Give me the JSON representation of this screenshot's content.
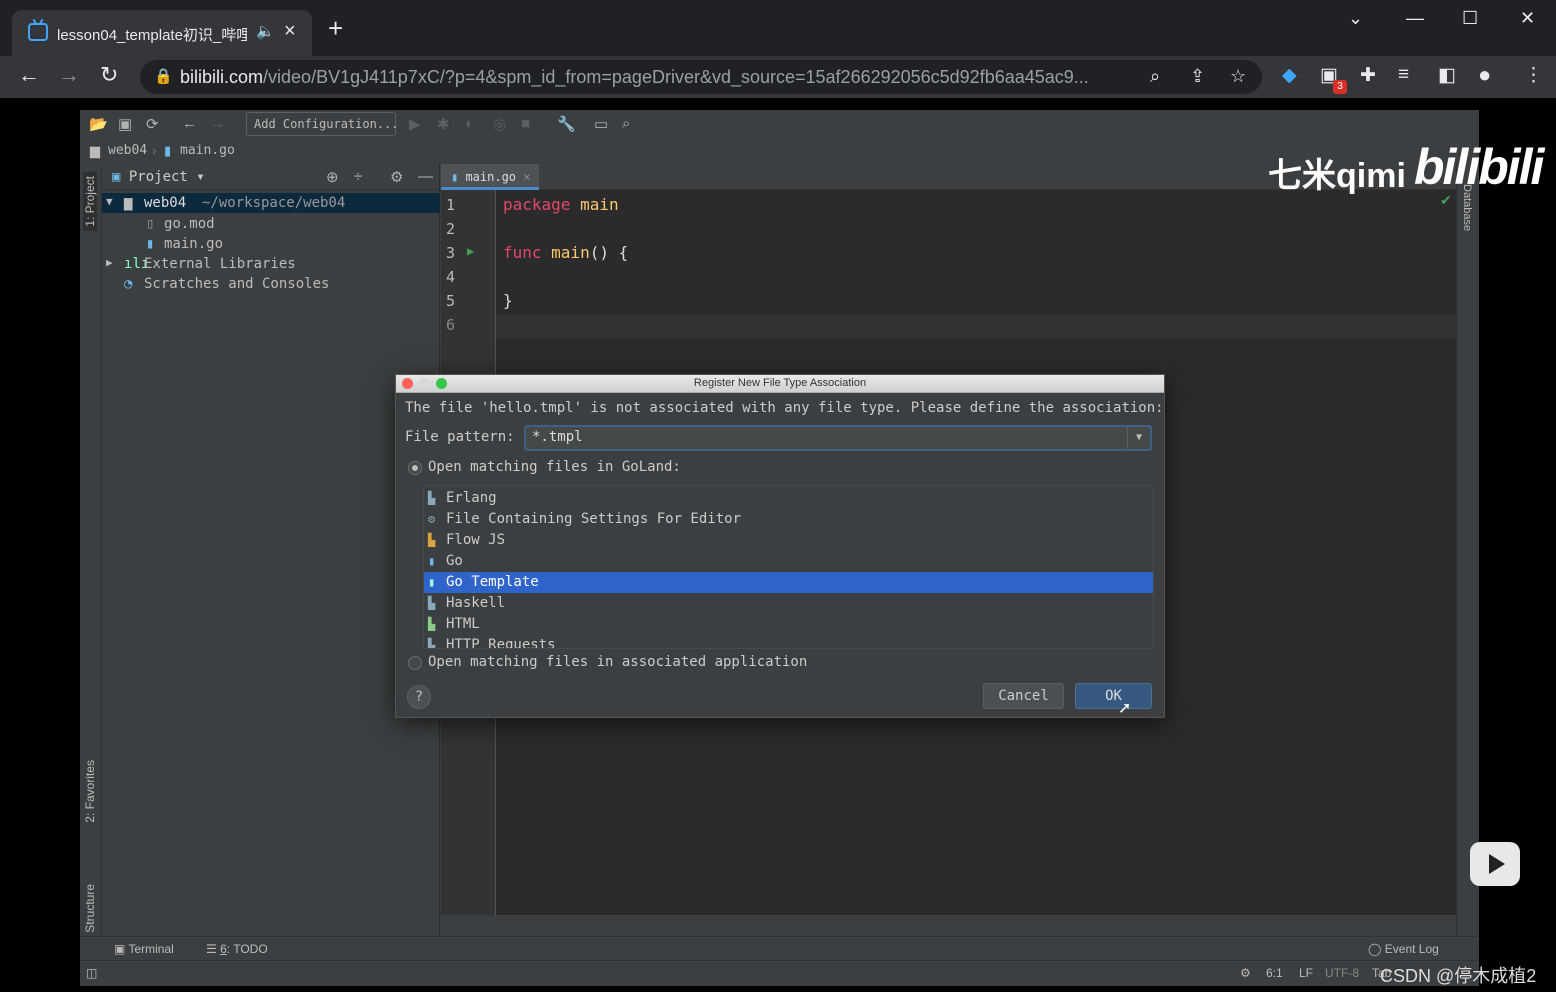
{
  "browser": {
    "tab_title": "lesson04_template初识_哔哩",
    "tab_audio_icon": "speaker-icon",
    "url_host": "bilibili.com",
    "url_path": "/video/BV1gJ411p7xC/?p=4&spm_id_from=pageDriver&vd_source=15af266292056c5d92fb6aa45ac9...",
    "extension_badge": "3"
  },
  "ide": {
    "add_config": "Add Configuration...",
    "breadcrumb": [
      "web04",
      "main.go"
    ],
    "left_tabs": [
      "1: Project",
      "2: Favorites",
      "7: Structure"
    ],
    "right_tab": "Database",
    "project": {
      "title": "Project",
      "tree": [
        {
          "name": "web04",
          "path": "~/workspace/web04"
        },
        {
          "name": "go.mod"
        },
        {
          "name": "main.go"
        },
        {
          "name": "External Libraries"
        },
        {
          "name": "Scratches and Consoles"
        }
      ]
    },
    "editor_tab": "main.go",
    "line_numbers": [
      "1",
      "2",
      "3",
      "4",
      "5",
      "6"
    ],
    "code": {
      "l1_kw": "package",
      "l1_rest": " main",
      "l3_kw": "func",
      "l3_fn": " main",
      "l3_rest": "() {",
      "l5": "}"
    },
    "bottom_tabs": {
      "terminal": "Terminal",
      "todo_num": "6",
      "todo": ": TODO",
      "event_log": "Event Log"
    },
    "status": {
      "position": "6:1",
      "line_sep": "LF",
      "encoding": "UTF-8",
      "extra": "Tab"
    }
  },
  "watermark": {
    "text": "七米qimi",
    "logo": "bilibili",
    "csdn": "CSDN @停木成植2"
  },
  "dialog": {
    "title": "Register New File Type Association",
    "message": "The file 'hello.tmpl' is not associated with any file type. Please define the association:",
    "pattern_label": "File pattern:",
    "pattern_value": "*.tmpl",
    "option_open_in_ide": "Open matching files in GoLand:",
    "option_open_assoc": "Open matching files in associated application",
    "file_types": [
      "Erlang",
      "File Containing Settings For Editor",
      "Flow JS",
      "Go",
      "Go Template",
      "Haskell",
      "HTML",
      "HTTP Requests"
    ],
    "selected_type": "Go Template",
    "help": "?",
    "cancel": "Cancel",
    "ok": "OK"
  }
}
